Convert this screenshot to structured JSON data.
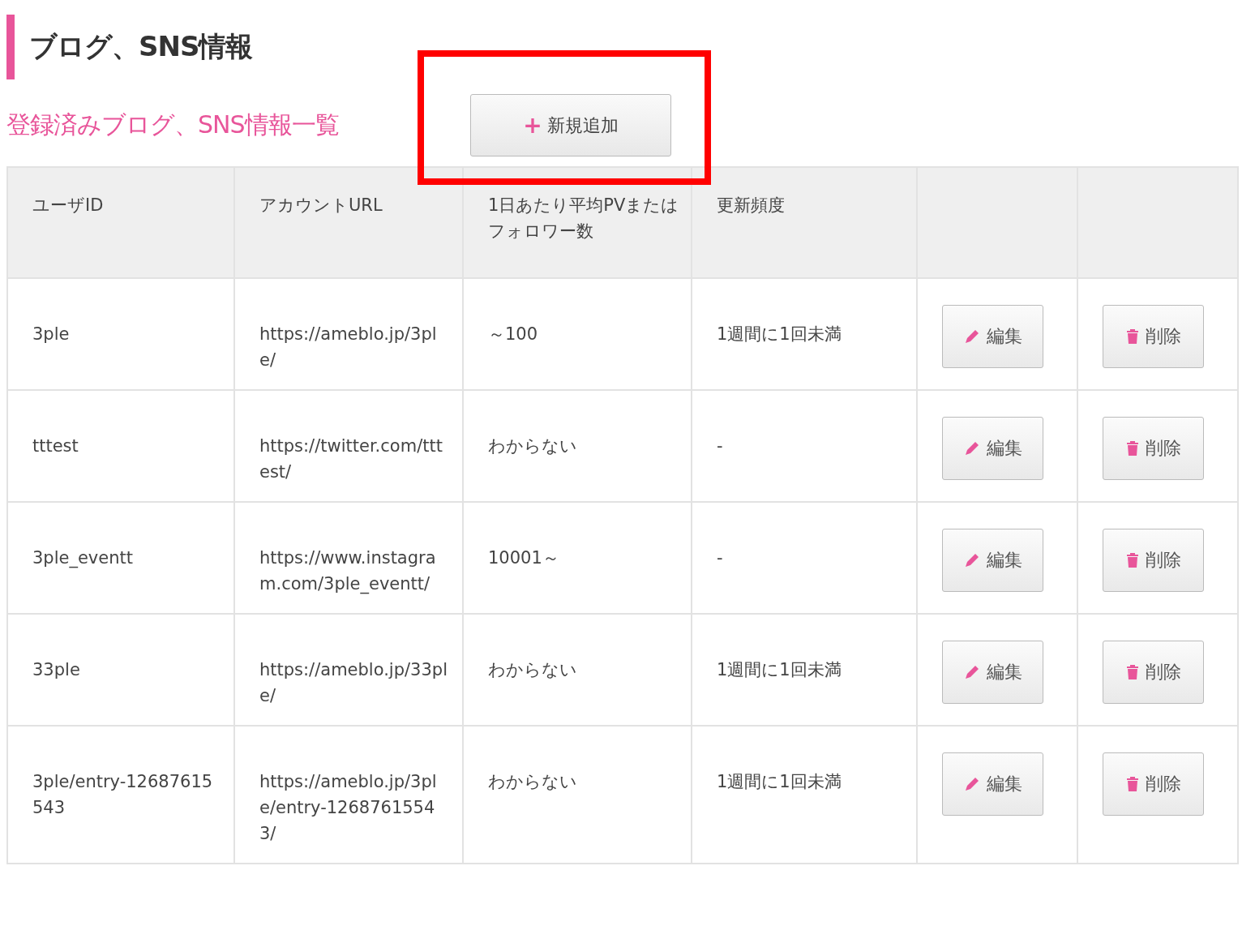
{
  "heading": "ブログ、SNS情報",
  "subheading": "登録済みブログ、SNS情報一覧",
  "add_button": {
    "icon": "+",
    "label": "新規追加"
  },
  "table": {
    "columns": [
      "ユーザID",
      "アカウントURL",
      "1日あたり平均PVまたはフォロワー数",
      "更新頻度"
    ],
    "rows": [
      {
        "user_id": "3ple",
        "url": "https://ameblo.jp/3ple/",
        "pv": "～100",
        "frequency": "1週間に1回未満",
        "edit": "編集",
        "delete": "削除"
      },
      {
        "user_id": "tttest",
        "url": "https://twitter.com/tttest/",
        "pv": "わからない",
        "frequency": "-",
        "edit": "編集",
        "delete": "削除"
      },
      {
        "user_id": "3ple_eventt",
        "url": "https://www.instagram.com/3ple_eventt/",
        "pv": "10001～",
        "frequency": "-",
        "edit": "編集",
        "delete": "削除"
      },
      {
        "user_id": "33ple",
        "url": "https://ameblo.jp/33ple/",
        "pv": "わからない",
        "frequency": "1週間に1回未満",
        "edit": "編集",
        "delete": "削除"
      },
      {
        "user_id": "3ple/entry-12687615543",
        "url": "https://ameblo.jp/3ple/entry-12687615543/",
        "pv": "わからない",
        "frequency": "1週間に1回未満",
        "edit": "編集",
        "delete": "削除"
      }
    ]
  }
}
